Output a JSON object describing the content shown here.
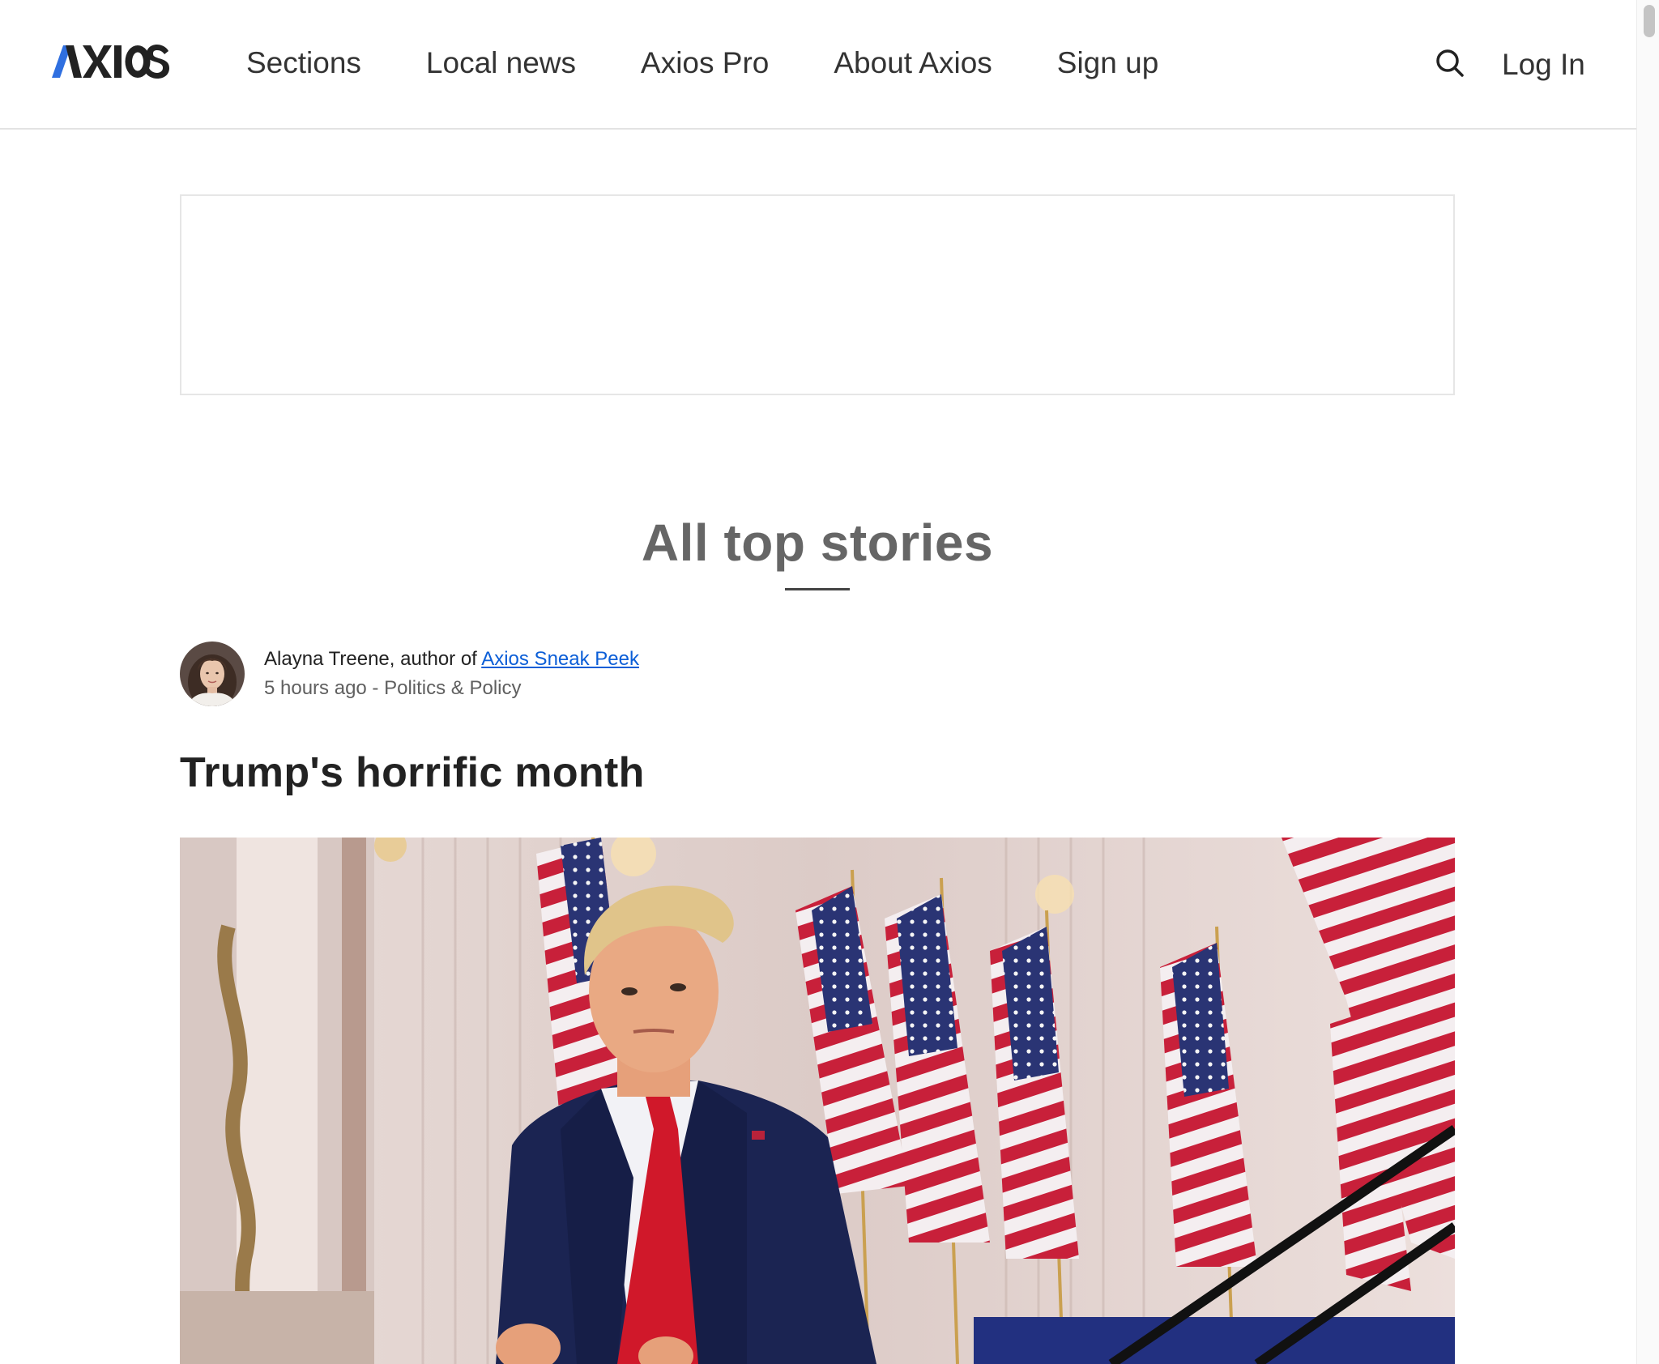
{
  "header": {
    "logo_text": "AXIOS",
    "nav": [
      {
        "label": "Sections"
      },
      {
        "label": "Local news"
      },
      {
        "label": "Axios Pro"
      },
      {
        "label": "About Axios"
      },
      {
        "label": "Sign up"
      }
    ],
    "search_icon": "search-icon",
    "login_label": "Log In"
  },
  "colors": {
    "brand_blue": "#2f6fe0",
    "link_blue": "#0b5ed7",
    "text_dark": "#222222",
    "text_muted": "#666666"
  },
  "main": {
    "section_title": "All top stories",
    "story": {
      "author": "Alayna Treene",
      "author_suffix": ", author of ",
      "newsletter": "Axios Sneak Peek",
      "time": "5 hours ago",
      "separator": " - ",
      "category": "Politics & Policy",
      "headline": "Trump's horrific month"
    }
  }
}
